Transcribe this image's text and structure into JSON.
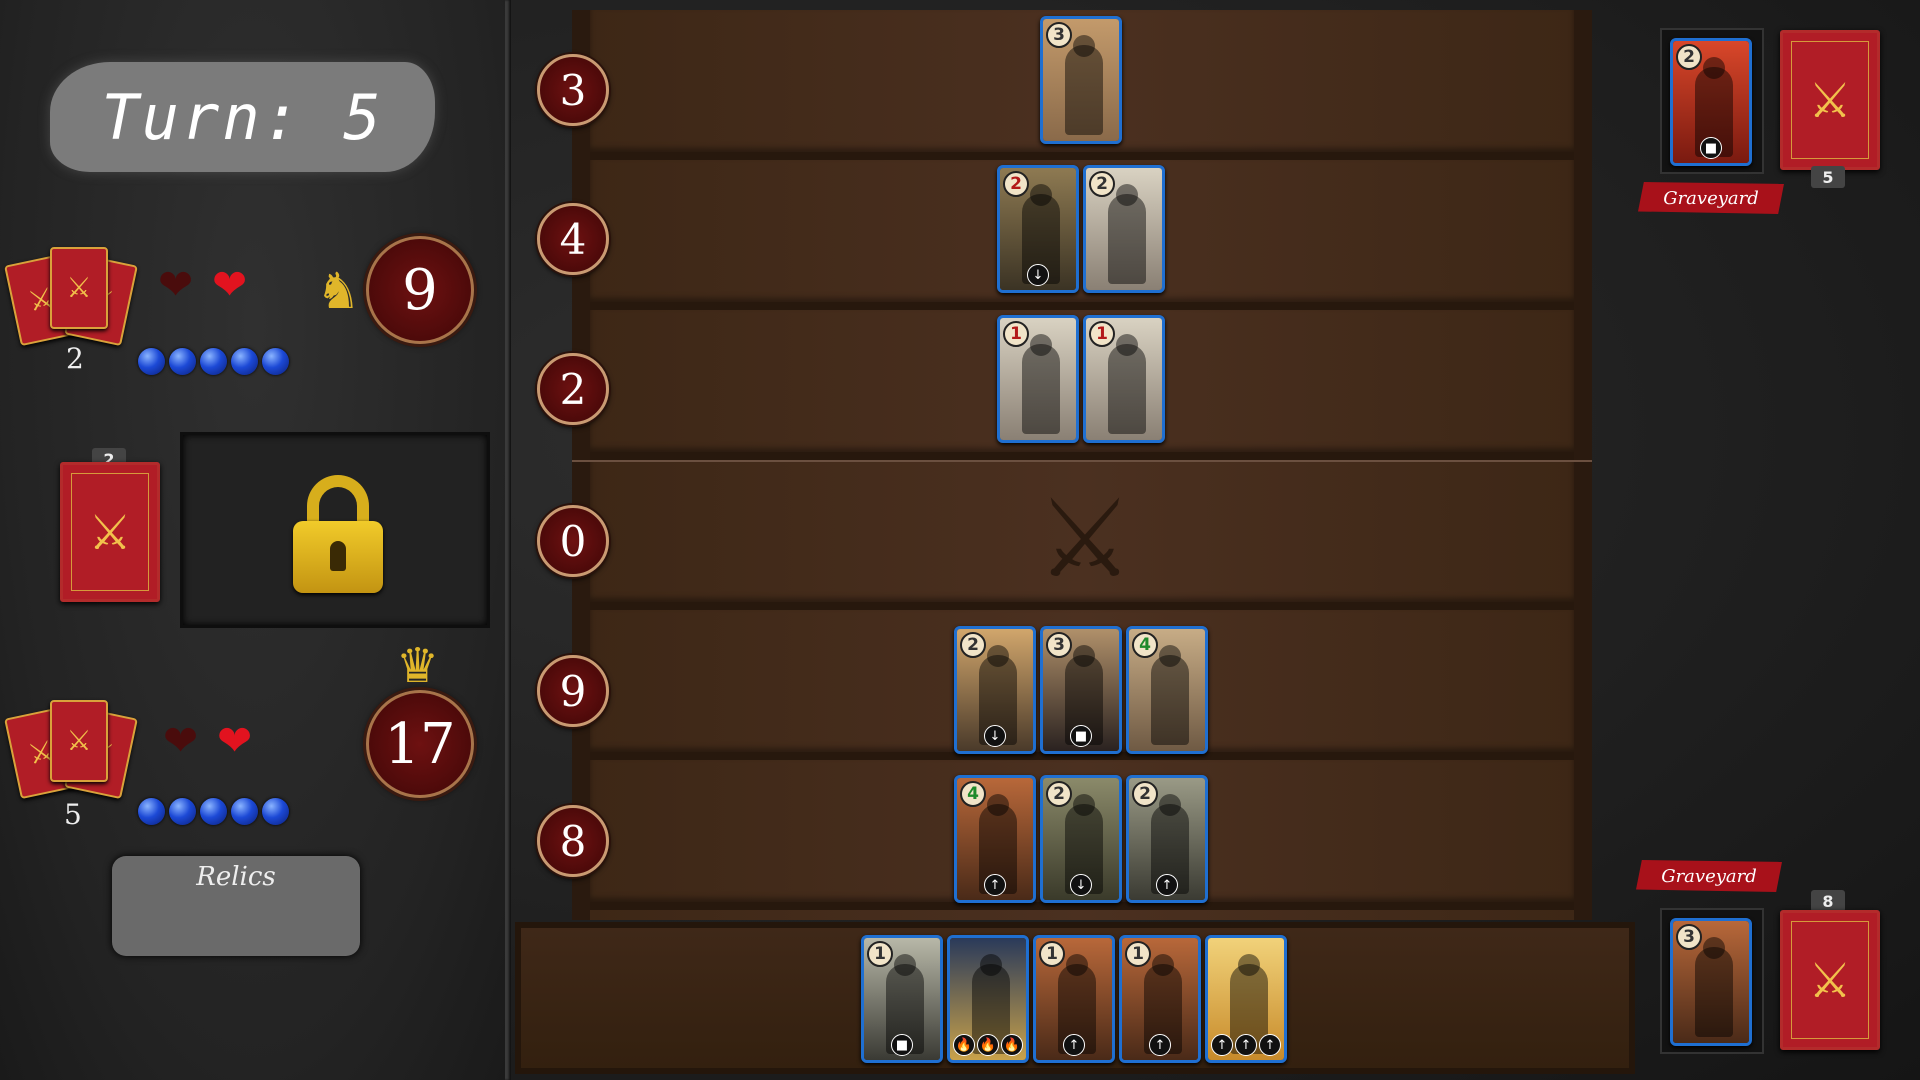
{
  "turn": {
    "label": "Turn: 5"
  },
  "opponent": {
    "deck_count": "2",
    "hearts": [
      "dark",
      "red"
    ],
    "mana": 5,
    "score": "9",
    "score_icon": "knight-icon"
  },
  "player": {
    "deck_count": "5",
    "hearts": [
      "dark",
      "red"
    ],
    "mana": 5,
    "score": "17",
    "score_icon": "crown-icon",
    "locked_deck_count": "2"
  },
  "relics": {
    "label": "Relics"
  },
  "lanes": [
    {
      "score": "3",
      "cards": [
        {
          "cost": "3",
          "cost_color": "#333333",
          "art": [
            "#c39a6b",
            "#8a6a4a"
          ],
          "icons": []
        }
      ]
    },
    {
      "score": "4",
      "cards": [
        {
          "cost": "2",
          "cost_color": "#b31919",
          "art": [
            "#8e7a52",
            "#3b3324"
          ],
          "icons": [
            "↓"
          ]
        },
        {
          "cost": "2",
          "cost_color": "#333333",
          "art": [
            "#d9d2c2",
            "#8a8074"
          ],
          "icons": []
        }
      ]
    },
    {
      "score": "2",
      "cards": [
        {
          "cost": "1",
          "cost_color": "#b31919",
          "art": [
            "#d9d2c2",
            "#8a8074"
          ],
          "icons": []
        },
        {
          "cost": "1",
          "cost_color": "#b31919",
          "art": [
            "#d9d2c2",
            "#8a8074"
          ],
          "icons": []
        }
      ]
    },
    {
      "score": "0",
      "cards": []
    },
    {
      "score": "9",
      "cards": [
        {
          "cost": "2",
          "cost_color": "#333333",
          "art": [
            "#d1a66c",
            "#4a3a2a"
          ],
          "icons": [
            "↓"
          ]
        },
        {
          "cost": "3",
          "cost_color": "#333333",
          "art": [
            "#b0906a",
            "#2a2220"
          ],
          "icons": [
            "■"
          ]
        },
        {
          "cost": "4",
          "cost_color": "#1f8a2a",
          "art": [
            "#c7ac86",
            "#6f5a44"
          ],
          "icons": []
        }
      ]
    },
    {
      "score": "8",
      "cards": [
        {
          "cost": "4",
          "cost_color": "#1f8a2a",
          "art": [
            "#b8683a",
            "#4a2a18"
          ],
          "icons": [
            "↑"
          ]
        },
        {
          "cost": "2",
          "cost_color": "#333333",
          "art": [
            "#8b8a6a",
            "#3a3a2a"
          ],
          "icons": [
            "↓"
          ]
        },
        {
          "cost": "2",
          "cost_color": "#333333",
          "art": [
            "#9a9a86",
            "#3b3b33"
          ],
          "icons": [
            "↑"
          ]
        }
      ]
    }
  ],
  "hand": [
    {
      "cost": "1",
      "cost_color": "#333333",
      "art": [
        "#b8b8a8",
        "#3a3a34"
      ],
      "icons": [
        "■"
      ]
    },
    {
      "cost": "",
      "cost_color": "#333333",
      "art": [
        "#2a3a5a",
        "#c9a24a"
      ],
      "icons": [
        "🔥",
        "🔥",
        "🔥"
      ]
    },
    {
      "cost": "1",
      "cost_color": "#333333",
      "art": [
        "#b8683a",
        "#4a2a18"
      ],
      "icons": [
        "↑"
      ]
    },
    {
      "cost": "1",
      "cost_color": "#333333",
      "art": [
        "#b8683a",
        "#4a2a18"
      ],
      "icons": [
        "↑"
      ]
    },
    {
      "cost": "",
      "cost_color": "#333333",
      "art": [
        "#f1d27a",
        "#c78a2a"
      ],
      "icons": [
        "↑",
        "↑",
        "↑"
      ]
    }
  ],
  "opponent_side": {
    "graveyard_label": "Graveyard",
    "graveyard_card": {
      "cost": "2",
      "cost_color": "#333333",
      "art": [
        "#d9472a",
        "#7a1a10"
      ],
      "icons": [
        "■"
      ]
    },
    "deck_count": "5"
  },
  "player_side": {
    "graveyard_label": "Graveyard",
    "graveyard_card": {
      "cost": "3",
      "cost_color": "#333333",
      "art": [
        "#b8683a",
        "#4a2a18"
      ],
      "icons": []
    },
    "deck_count": "8"
  },
  "colors": {
    "board_wood": "#4b3020",
    "score_red": "#6e1111",
    "card_border": "#1f6fd1",
    "card_back": "#b11d26"
  }
}
